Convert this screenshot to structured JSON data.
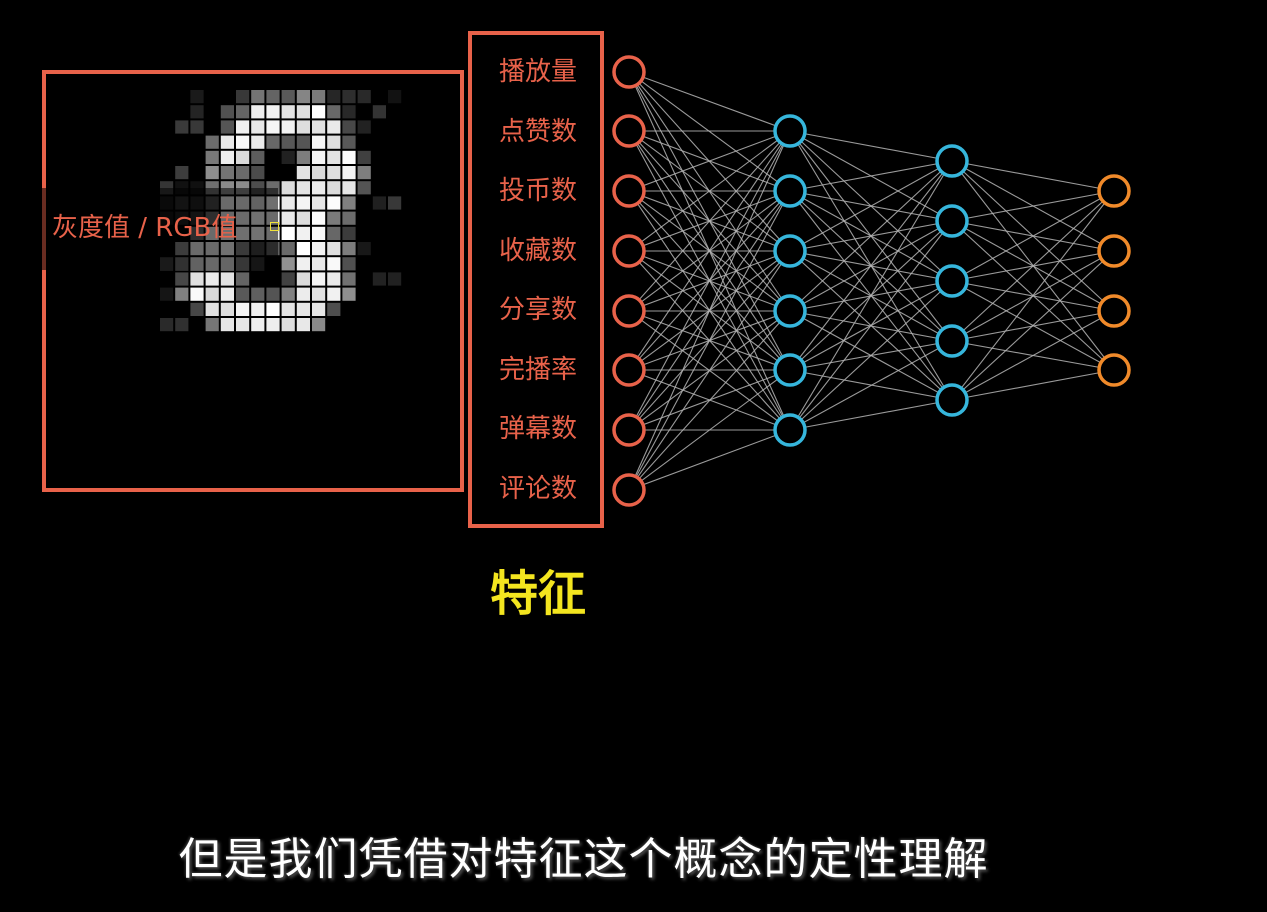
{
  "image_panel": {
    "pixel_label": "灰度值 / RGB值"
  },
  "features": [
    "播放量",
    "点赞数",
    "投币数",
    "收藏数",
    "分享数",
    "完播率",
    "弹幕数",
    "评论数"
  ],
  "features_caption": "特征",
  "subtitle": "但是我们凭借对特征这个概念的定性理解",
  "network": {
    "layers": [
      8,
      6,
      5,
      4
    ],
    "layer_colors": [
      "#e8624a",
      "#36b6dc",
      "#36b6dc",
      "#f08a2a"
    ],
    "edge_color": "#b5b5b5"
  },
  "colors": {
    "accent": "#e8624a",
    "caption": "#f3e51f",
    "background": "#000000"
  }
}
